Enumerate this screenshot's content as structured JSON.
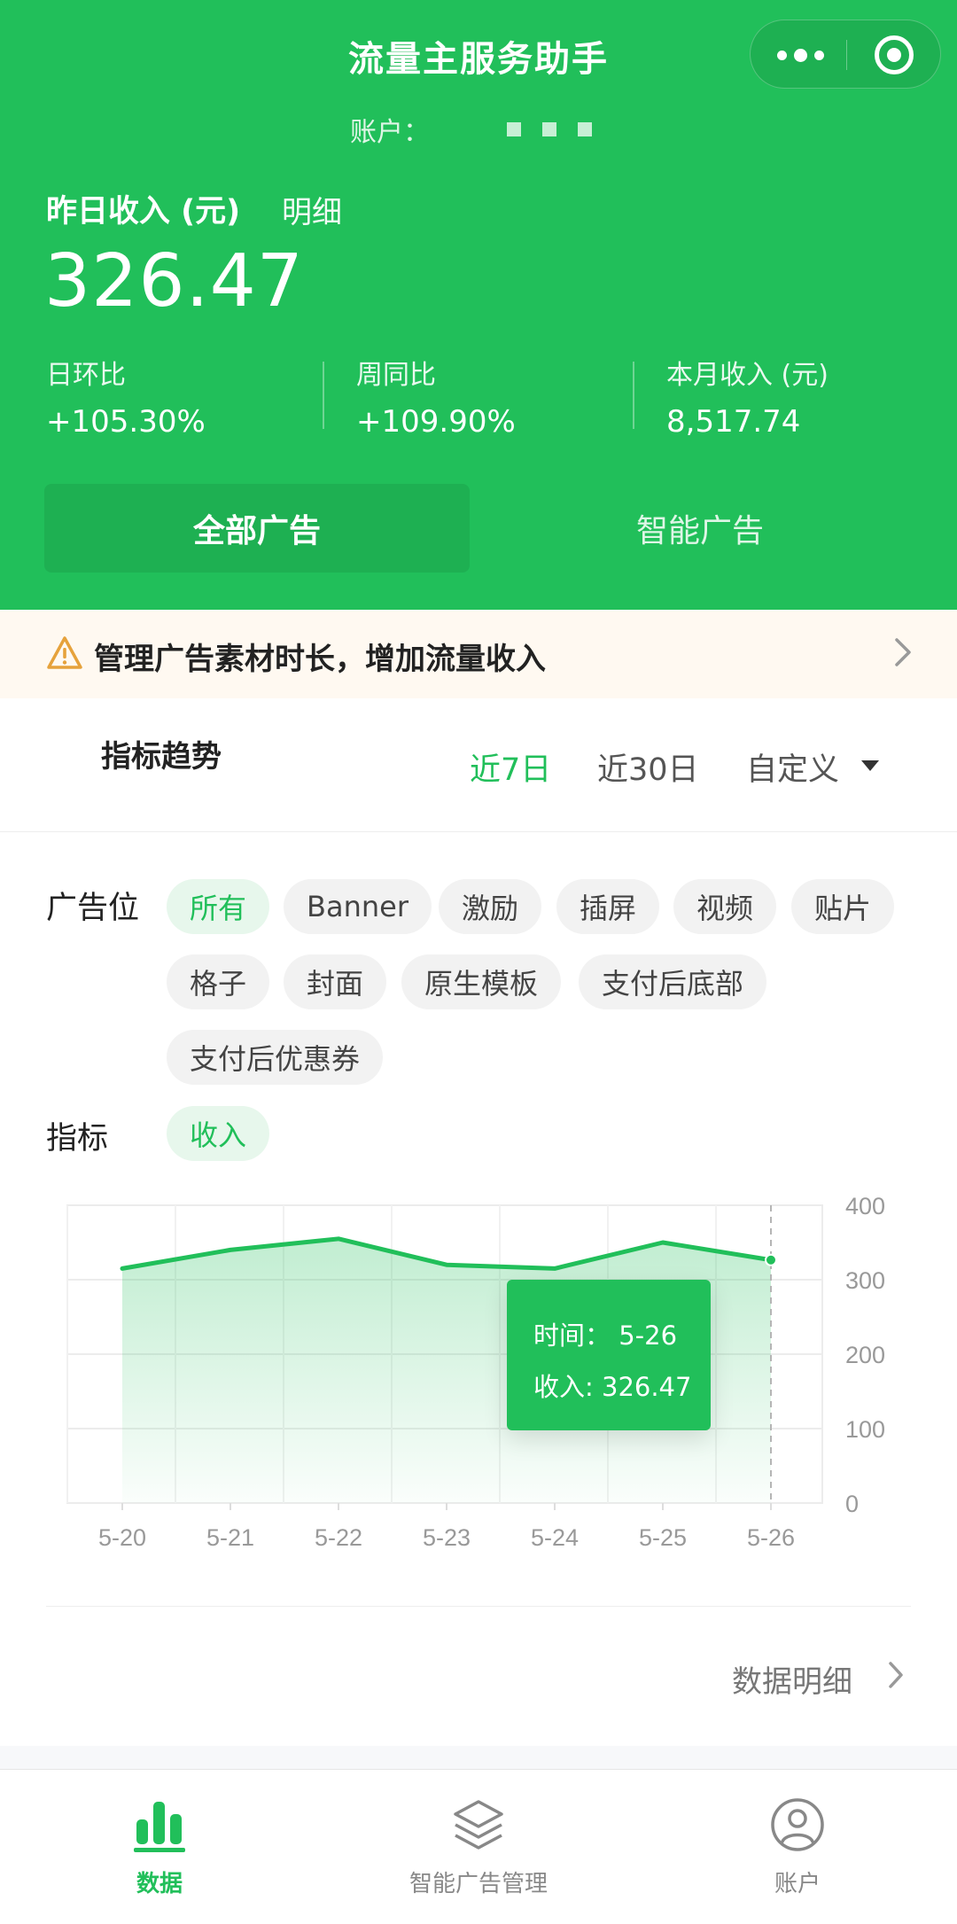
{
  "header": {
    "title": "流量主服务助手",
    "account_label": "账户：",
    "income_label": "昨日收入 (元)",
    "detail_link": "明细",
    "income_value": "326.47",
    "stats": [
      {
        "label": "日环比",
        "value": "+105.30%"
      },
      {
        "label": "周同比",
        "value": "+109.90%"
      },
      {
        "label": "本月收入 (元)",
        "value": "8,517.74"
      }
    ],
    "ad_tabs": [
      "全部广告",
      "智能广告"
    ]
  },
  "notice": {
    "text": "管理广告素材时长，增加流量收入"
  },
  "trend": {
    "title": "指标趋势",
    "ranges": [
      "近7日",
      "近30日",
      "自定义"
    ],
    "placement_label": "广告位",
    "placements": [
      "所有",
      "Banner",
      "激励",
      "插屏",
      "视频",
      "贴片",
      "格子",
      "封面",
      "原生模板",
      "支付后底部",
      "支付后优惠券"
    ],
    "metric_label": "指标",
    "metrics": [
      "收入"
    ]
  },
  "tooltip": {
    "time_line": "时间：  5-26",
    "value_line": "收入: 326.47"
  },
  "data_detail": "数据明细",
  "tabbar": [
    "数据",
    "智能广告管理",
    "账户"
  ],
  "colors": {
    "primary": "#21bf5a",
    "notice_bg": "#fff9f1",
    "warning": "#e6a23c"
  },
  "icons": {
    "more": "more-dots-icon",
    "close": "target-icon",
    "warning": "warning-icon",
    "data_tab": "bar-chart-icon",
    "smart_ad_tab": "layers-icon",
    "account_tab": "user-icon"
  },
  "chart_data": {
    "type": "area",
    "categories": [
      "5-20",
      "5-21",
      "5-22",
      "5-23",
      "5-24",
      "5-25",
      "5-26"
    ],
    "series": [
      {
        "name": "收入",
        "values": [
          315,
          340,
          355,
          320,
          315,
          350,
          326.47
        ]
      }
    ],
    "ylim": [
      0,
      400
    ],
    "yticks": [
      0,
      100,
      200,
      300,
      400
    ],
    "y_axis_side": "right",
    "grid": true,
    "highlight": "5-26"
  }
}
